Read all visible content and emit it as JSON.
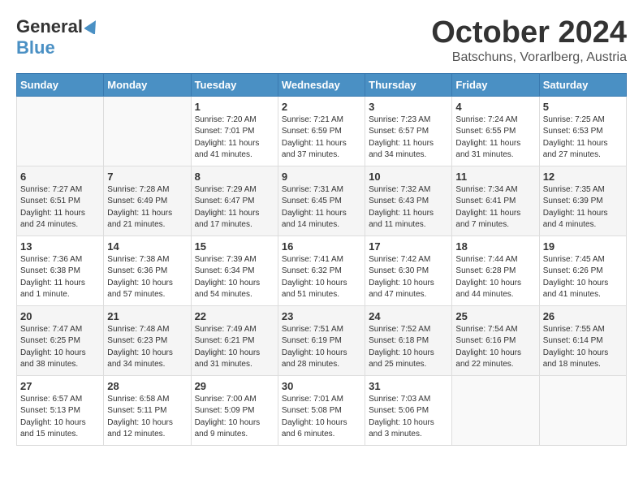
{
  "header": {
    "logo_general": "General",
    "logo_blue": "Blue",
    "month": "October 2024",
    "location": "Batschuns, Vorarlberg, Austria"
  },
  "days_of_week": [
    "Sunday",
    "Monday",
    "Tuesday",
    "Wednesday",
    "Thursday",
    "Friday",
    "Saturday"
  ],
  "weeks": [
    [
      {
        "day": "",
        "info": ""
      },
      {
        "day": "",
        "info": ""
      },
      {
        "day": "1",
        "info": "Sunrise: 7:20 AM\nSunset: 7:01 PM\nDaylight: 11 hours and 41 minutes."
      },
      {
        "day": "2",
        "info": "Sunrise: 7:21 AM\nSunset: 6:59 PM\nDaylight: 11 hours and 37 minutes."
      },
      {
        "day": "3",
        "info": "Sunrise: 7:23 AM\nSunset: 6:57 PM\nDaylight: 11 hours and 34 minutes."
      },
      {
        "day": "4",
        "info": "Sunrise: 7:24 AM\nSunset: 6:55 PM\nDaylight: 11 hours and 31 minutes."
      },
      {
        "day": "5",
        "info": "Sunrise: 7:25 AM\nSunset: 6:53 PM\nDaylight: 11 hours and 27 minutes."
      }
    ],
    [
      {
        "day": "6",
        "info": "Sunrise: 7:27 AM\nSunset: 6:51 PM\nDaylight: 11 hours and 24 minutes."
      },
      {
        "day": "7",
        "info": "Sunrise: 7:28 AM\nSunset: 6:49 PM\nDaylight: 11 hours and 21 minutes."
      },
      {
        "day": "8",
        "info": "Sunrise: 7:29 AM\nSunset: 6:47 PM\nDaylight: 11 hours and 17 minutes."
      },
      {
        "day": "9",
        "info": "Sunrise: 7:31 AM\nSunset: 6:45 PM\nDaylight: 11 hours and 14 minutes."
      },
      {
        "day": "10",
        "info": "Sunrise: 7:32 AM\nSunset: 6:43 PM\nDaylight: 11 hours and 11 minutes."
      },
      {
        "day": "11",
        "info": "Sunrise: 7:34 AM\nSunset: 6:41 PM\nDaylight: 11 hours and 7 minutes."
      },
      {
        "day": "12",
        "info": "Sunrise: 7:35 AM\nSunset: 6:39 PM\nDaylight: 11 hours and 4 minutes."
      }
    ],
    [
      {
        "day": "13",
        "info": "Sunrise: 7:36 AM\nSunset: 6:38 PM\nDaylight: 11 hours and 1 minute."
      },
      {
        "day": "14",
        "info": "Sunrise: 7:38 AM\nSunset: 6:36 PM\nDaylight: 10 hours and 57 minutes."
      },
      {
        "day": "15",
        "info": "Sunrise: 7:39 AM\nSunset: 6:34 PM\nDaylight: 10 hours and 54 minutes."
      },
      {
        "day": "16",
        "info": "Sunrise: 7:41 AM\nSunset: 6:32 PM\nDaylight: 10 hours and 51 minutes."
      },
      {
        "day": "17",
        "info": "Sunrise: 7:42 AM\nSunset: 6:30 PM\nDaylight: 10 hours and 47 minutes."
      },
      {
        "day": "18",
        "info": "Sunrise: 7:44 AM\nSunset: 6:28 PM\nDaylight: 10 hours and 44 minutes."
      },
      {
        "day": "19",
        "info": "Sunrise: 7:45 AM\nSunset: 6:26 PM\nDaylight: 10 hours and 41 minutes."
      }
    ],
    [
      {
        "day": "20",
        "info": "Sunrise: 7:47 AM\nSunset: 6:25 PM\nDaylight: 10 hours and 38 minutes."
      },
      {
        "day": "21",
        "info": "Sunrise: 7:48 AM\nSunset: 6:23 PM\nDaylight: 10 hours and 34 minutes."
      },
      {
        "day": "22",
        "info": "Sunrise: 7:49 AM\nSunset: 6:21 PM\nDaylight: 10 hours and 31 minutes."
      },
      {
        "day": "23",
        "info": "Sunrise: 7:51 AM\nSunset: 6:19 PM\nDaylight: 10 hours and 28 minutes."
      },
      {
        "day": "24",
        "info": "Sunrise: 7:52 AM\nSunset: 6:18 PM\nDaylight: 10 hours and 25 minutes."
      },
      {
        "day": "25",
        "info": "Sunrise: 7:54 AM\nSunset: 6:16 PM\nDaylight: 10 hours and 22 minutes."
      },
      {
        "day": "26",
        "info": "Sunrise: 7:55 AM\nSunset: 6:14 PM\nDaylight: 10 hours and 18 minutes."
      }
    ],
    [
      {
        "day": "27",
        "info": "Sunrise: 6:57 AM\nSunset: 5:13 PM\nDaylight: 10 hours and 15 minutes."
      },
      {
        "day": "28",
        "info": "Sunrise: 6:58 AM\nSunset: 5:11 PM\nDaylight: 10 hours and 12 minutes."
      },
      {
        "day": "29",
        "info": "Sunrise: 7:00 AM\nSunset: 5:09 PM\nDaylight: 10 hours and 9 minutes."
      },
      {
        "day": "30",
        "info": "Sunrise: 7:01 AM\nSunset: 5:08 PM\nDaylight: 10 hours and 6 minutes."
      },
      {
        "day": "31",
        "info": "Sunrise: 7:03 AM\nSunset: 5:06 PM\nDaylight: 10 hours and 3 minutes."
      },
      {
        "day": "",
        "info": ""
      },
      {
        "day": "",
        "info": ""
      }
    ]
  ]
}
